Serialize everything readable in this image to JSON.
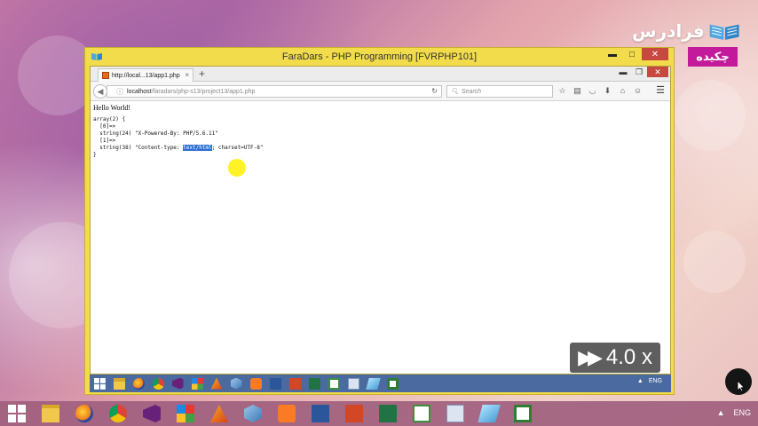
{
  "brand": {
    "logo_text": "فرادرس",
    "badge": "چکیده"
  },
  "window": {
    "title": "FaraDars - PHP Programming [FVRPHP101]",
    "controls": {
      "minimize": "▬",
      "maximize": "□",
      "close": "✕"
    }
  },
  "browser": {
    "tab_title": "http://local...13/app1.php",
    "new_tab": "+",
    "url_host": "localhost",
    "url_path": "/faradars/php-s13/project13/app1.php",
    "search_placeholder": "Search"
  },
  "page": {
    "heading": "Hello World!",
    "dump_lines": [
      "array(2) {",
      "  [0]=>",
      "  string(24) \"X-Powered-By: PHP/5.6.11\"",
      "  [1]=>"
    ],
    "line5_prefix": "  string(38) \"Content-type: ",
    "line5_selected": "text/html",
    "line5_suffix": "; charset=UTF-8\"",
    "dump_close": "}"
  },
  "playback": {
    "speed": "4.0 x"
  },
  "tray": {
    "language": "ENG",
    "inner_language": "ENG"
  },
  "taskbar_apps": [
    "start",
    "file-explorer",
    "firefox",
    "chrome",
    "visual-studio",
    "blocks",
    "matlab",
    "virtualbox",
    "xampp",
    "word",
    "powerpoint",
    "excel",
    "chart-app",
    "calculator",
    "paint",
    "camtasia"
  ]
}
